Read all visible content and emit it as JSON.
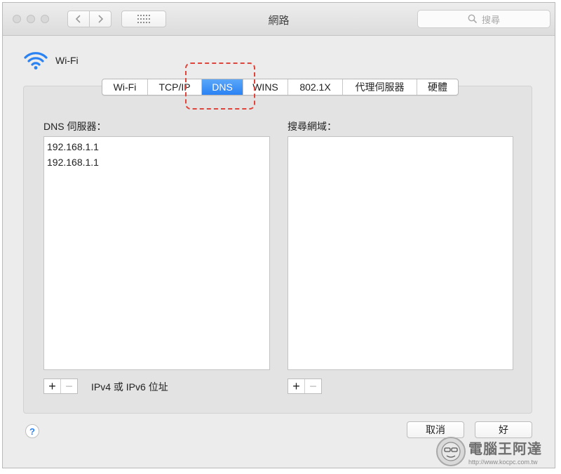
{
  "window": {
    "title": "網路",
    "search_placeholder": "搜尋"
  },
  "interface": {
    "name": "Wi-Fi",
    "icon": "wifi-icon",
    "accent_color": "#2a82f3"
  },
  "tabs": [
    {
      "label": "Wi-Fi",
      "active": false
    },
    {
      "label": "TCP/IP",
      "active": false
    },
    {
      "label": "DNS",
      "active": true
    },
    {
      "label": "WINS",
      "active": false
    },
    {
      "label": "802.1X",
      "active": false
    },
    {
      "label": "代理伺服器",
      "active": false
    },
    {
      "label": "硬體",
      "active": false
    }
  ],
  "dns": {
    "label": "DNS 伺服器：",
    "servers": [
      "192.168.1.1",
      "192.168.1.1"
    ],
    "hint": "IPv4 或 IPv6 位址",
    "add_label": "+",
    "remove_label": "−"
  },
  "search_domains": {
    "label": "搜尋網域：",
    "domains": [],
    "add_label": "+",
    "remove_label": "−"
  },
  "footer": {
    "help_label": "?",
    "cancel_label": "取消",
    "ok_label": "好"
  },
  "watermark": {
    "brand": "電腦王阿達",
    "url": "http://www.kocpc.com.tw"
  },
  "annotation": {
    "highlight_color": "#e0443a"
  }
}
